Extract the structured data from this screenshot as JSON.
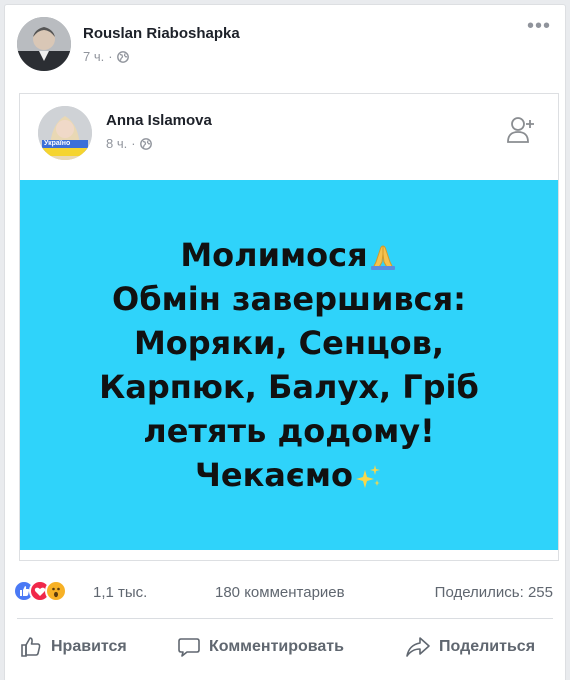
{
  "post": {
    "author": "Rouslan Riaboshapka",
    "time": "7 ч.",
    "separator": "·",
    "more_label": "•••"
  },
  "shared": {
    "author": "Anna Islamova",
    "time": "8 ч.",
    "separator": "·",
    "avatar_badge_text": "Україно"
  },
  "banner": {
    "background": "#2fd3fa",
    "lines": [
      "Молимося",
      "Обмін завершився:",
      "Моряки, Сенцов,",
      "Карпюк, Балух, Гріб",
      "летять додому!",
      "Чекаємо"
    ]
  },
  "stats": {
    "reactions": [
      "like",
      "love",
      "wow"
    ],
    "reaction_count": "1,1 тыс.",
    "comments": "180 комментариев",
    "shares": "Поделились: 255"
  },
  "actions": {
    "like": "Нравится",
    "comment": "Комментировать",
    "share": "Поделиться"
  },
  "colors": {
    "text_primary": "#1d2129",
    "text_secondary": "#90949c",
    "action_text": "#606770",
    "like_blue": "#4a79f5",
    "love_red": "#f0284a",
    "wow_yellow": "#f7b125"
  }
}
